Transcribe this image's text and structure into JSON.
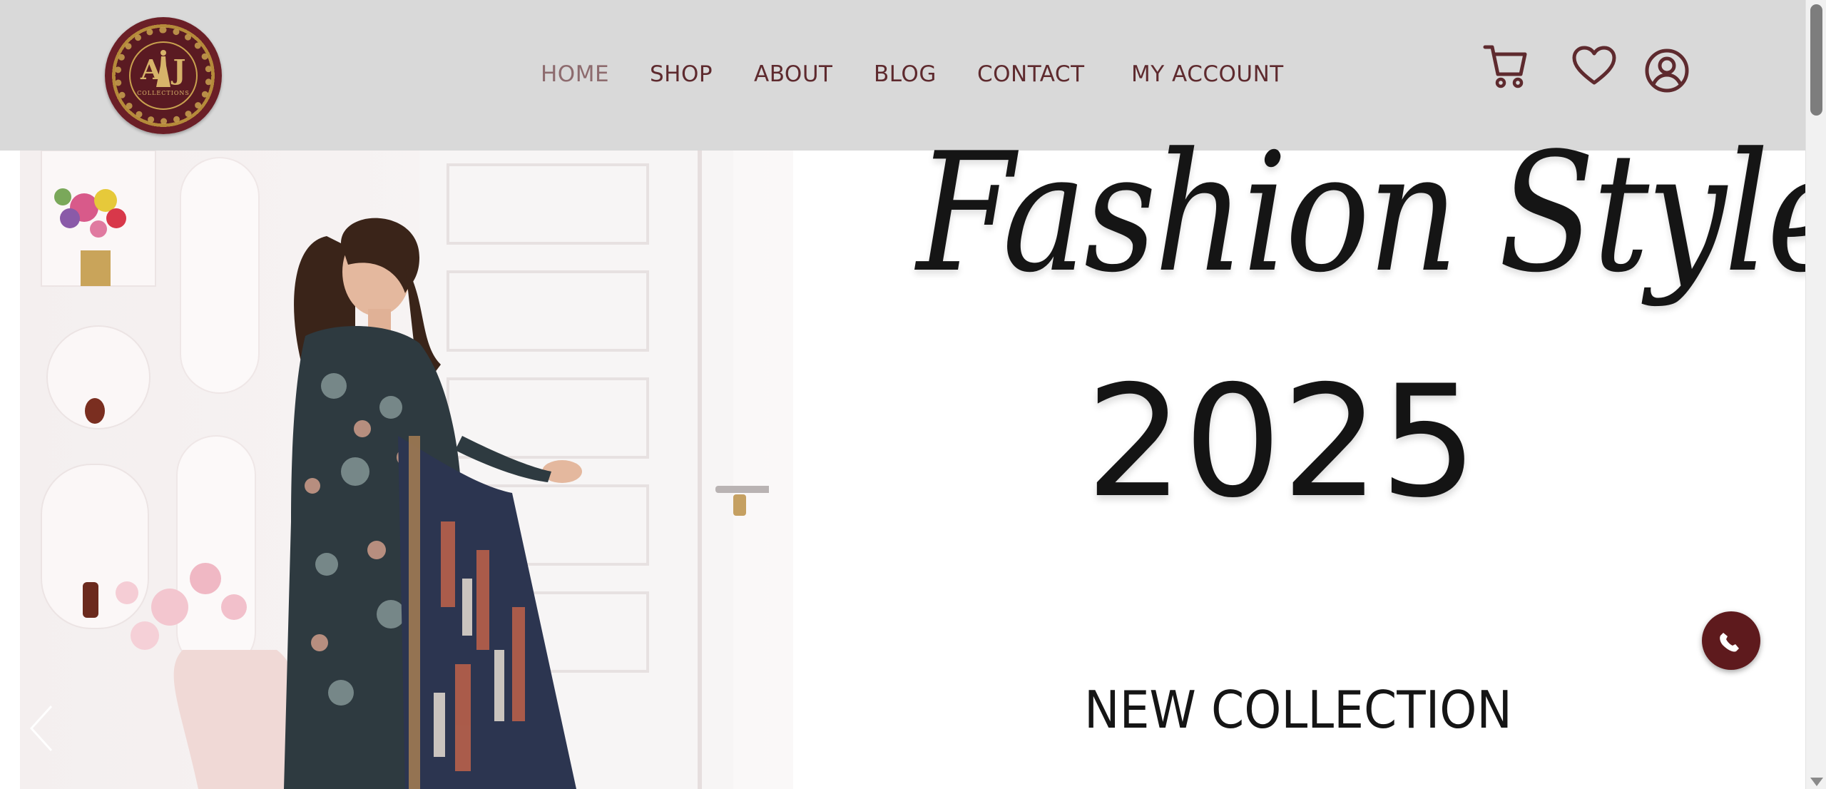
{
  "brand": {
    "logo_letters": "AJ",
    "logo_subtitle": "COLLECTIONS"
  },
  "nav": {
    "items": [
      {
        "label": "HOME",
        "active": true
      },
      {
        "label": "SHOP",
        "active": false
      },
      {
        "label": "ABOUT",
        "active": false
      },
      {
        "label": "BLOG",
        "active": false
      },
      {
        "label": "CONTACT",
        "active": false
      },
      {
        "label": "MY ACCOUNT",
        "active": false
      }
    ]
  },
  "header_icons": [
    "cart-icon",
    "heart-icon",
    "user-account-icon"
  ],
  "hero": {
    "script_title": "Fashion Style",
    "year": "2025",
    "subtitle": "NEW COLLECTION"
  },
  "floating": {
    "call_icon": "phone-icon"
  },
  "colors": {
    "header_bg": "#d9d9d9",
    "brand_maroon": "#5e2a2e",
    "nav_active": "#8d6b6e",
    "call_button": "#5e1a1d"
  }
}
